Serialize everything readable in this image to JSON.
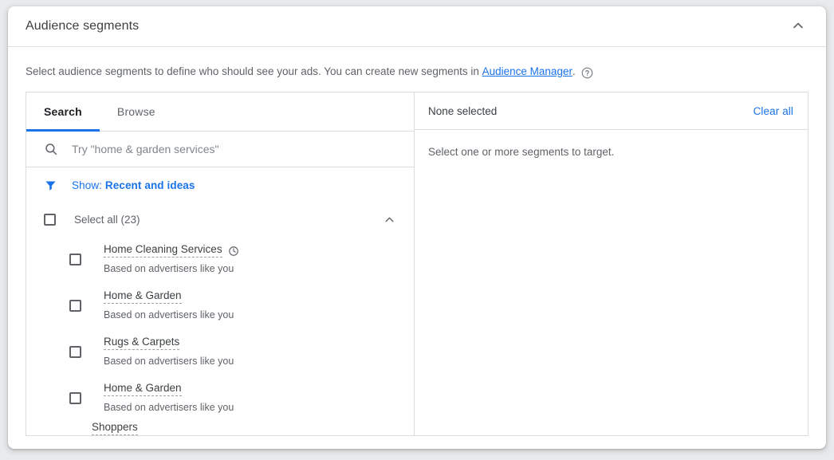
{
  "card": {
    "title": "Audience segments",
    "collapse_icon": "chevron-up-icon"
  },
  "description": {
    "text_before": "Select audience segments to define who should see your ads. You can create new segments in ",
    "link_label": "Audience Manager",
    "text_after": ".",
    "help_icon": "help-circle-icon"
  },
  "tabs": [
    {
      "label": "Search",
      "active": true
    },
    {
      "label": "Browse",
      "active": false
    }
  ],
  "search": {
    "icon": "search-icon",
    "value": "",
    "placeholder": "Try \"home & garden services\""
  },
  "filter": {
    "icon": "filter-funnel-icon",
    "prefix": "Show: ",
    "value": "Recent and ideas"
  },
  "select_all": {
    "label": "Select all (23)",
    "checked": false,
    "chevron_icon": "chevron-up-icon"
  },
  "segments": [
    {
      "name": "Home Cleaning Services",
      "subtitle": "Based on advertisers like you",
      "checked": false,
      "badge_icon": "clock-icon"
    },
    {
      "name": "Home & Garden",
      "subtitle": "Based on advertisers like you",
      "checked": false,
      "badge_icon": ""
    },
    {
      "name": "Rugs & Carpets",
      "subtitle": "Based on advertisers like you",
      "checked": false,
      "badge_icon": ""
    },
    {
      "name": "Home & Garden",
      "subtitle": "Based on advertisers like you",
      "checked": false,
      "badge_icon": ""
    },
    {
      "name": "Shoppers",
      "subtitle": "",
      "checked": false,
      "badge_icon": ""
    }
  ],
  "selection_panel": {
    "status": "None selected",
    "clear_all_label": "Clear all",
    "empty_message": "Select one or more segments to target."
  },
  "colors": {
    "accent_blue": "#1a73e8",
    "text_primary": "#3c4043",
    "text_secondary": "#5f6368",
    "border": "#dadce0",
    "page_background": "#e9eaec"
  }
}
